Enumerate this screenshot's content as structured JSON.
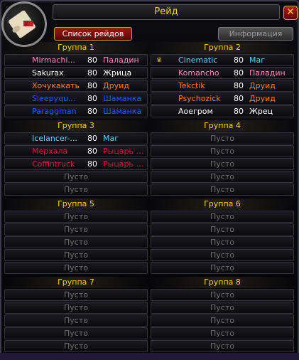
{
  "window": {
    "title": "Рейд",
    "close_label": "✕"
  },
  "tabs": {
    "raid_list": "Список рейдов",
    "info": "Информация"
  },
  "empty_label": "Пусто",
  "class_colors": {
    "paladin": "#f58cba",
    "priest": "#ffffff",
    "druid": "#ff7d0a",
    "shaman": "#2459ff",
    "mage": "#69ccf0",
    "deathknight": "#c41f3b"
  },
  "groups": [
    {
      "title": "Группа 1",
      "members": [
        {
          "name": "Mirmachi...",
          "level": "80",
          "class": "Паладин",
          "color": "#f58cba"
        },
        {
          "name": "Sakurax",
          "level": "80",
          "class": "Жрица",
          "color": "#ffffff"
        },
        {
          "name": "Хочукакать",
          "level": "80",
          "class": "Друид",
          "color": "#ff7d0a"
        },
        {
          "name": "Sleepyqu...",
          "level": "80",
          "class": "Шаманка",
          "color": "#2459ff"
        },
        {
          "name": "Paraggman",
          "level": "80",
          "class": "Шаманка",
          "color": "#2459ff"
        }
      ]
    },
    {
      "title": "Группа 2",
      "members": [
        {
          "name": "Cinematic",
          "level": "80",
          "class": "Маг",
          "color": "#69ccf0",
          "leader": true
        },
        {
          "name": "Komancho",
          "level": "80",
          "class": "Паладин",
          "color": "#f58cba"
        },
        {
          "name": "Tekctik",
          "level": "80",
          "class": "Друид",
          "color": "#ff7d0a"
        },
        {
          "name": "Psychozick",
          "level": "80",
          "class": "Друид",
          "color": "#ff7d0a"
        },
        {
          "name": "Аоегром",
          "level": "80",
          "class": "Жрец",
          "color": "#ffffff"
        }
      ]
    },
    {
      "title": "Группа 3",
      "members": [
        {
          "name": "Icelancer-...",
          "level": "80",
          "class": "Маг",
          "color": "#69ccf0"
        },
        {
          "name": "Мерхала",
          "level": "80",
          "class": "Рыцарь с...",
          "color": "#c41f3b"
        },
        {
          "name": "Coffintruck",
          "level": "80",
          "class": "Рыцарь с...",
          "color": "#c41f3b"
        },
        null,
        null
      ]
    },
    {
      "title": "Группа 4",
      "members": [
        null,
        null,
        null,
        null,
        null
      ]
    },
    {
      "title": "Группа 5",
      "members": [
        null,
        null,
        null,
        null,
        null
      ]
    },
    {
      "title": "Группа 6",
      "members": [
        null,
        null,
        null,
        null,
        null
      ]
    },
    {
      "title": "Группа 7",
      "members": [
        null,
        null,
        null,
        null,
        null
      ]
    },
    {
      "title": "Группа 8",
      "members": [
        null,
        null,
        null,
        null,
        null
      ]
    }
  ]
}
